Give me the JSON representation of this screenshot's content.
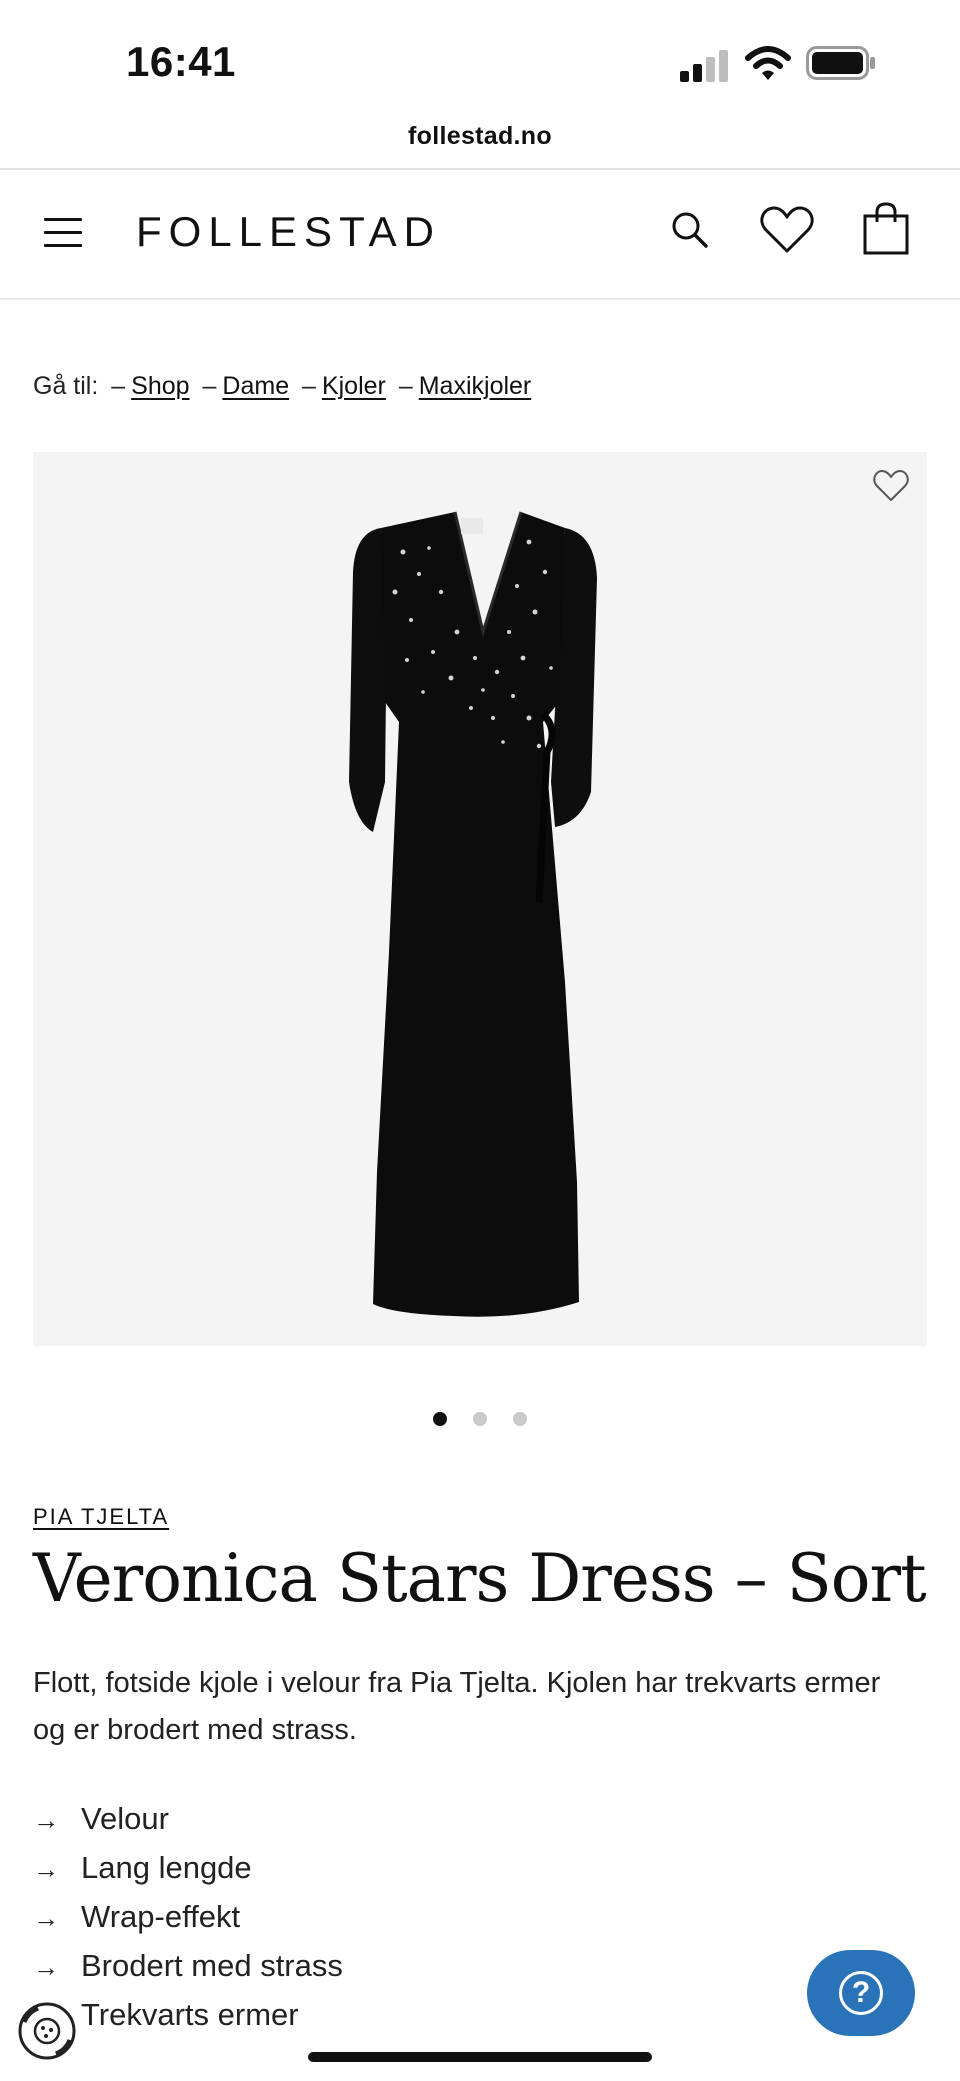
{
  "status_bar": {
    "time": "16:41"
  },
  "browser": {
    "url": "follestad.no"
  },
  "header": {
    "logo": "FOLLESTAD"
  },
  "breadcrumb": {
    "prefix": "Gå til:",
    "separator": "–",
    "items": [
      "Shop",
      "Dame",
      "Kjoler",
      "Maxikjoler"
    ]
  },
  "product": {
    "brand": "PIA TJELTA",
    "title": "Veronica Stars Dress – Sort",
    "description": "Flott, fotside kjole i velour fra Pia Tjelta. Kjolen har trekvarts ermer og er brodert med strass.",
    "features": [
      "Velour",
      "Lang lengde",
      "Wrap-effekt",
      "Brodert med strass",
      "Trekvarts ermer"
    ],
    "feature_arrow": "→",
    "image_count": 3,
    "active_image": 1
  },
  "help": {
    "icon": "?"
  },
  "icons": {
    "menu": "hamburger-icon",
    "search": "search-icon",
    "wishlist": "heart-icon",
    "cart": "shopping-bag-icon"
  },
  "colors": {
    "help_button": "#2b73b9",
    "image_bg": "#f4f4f4",
    "text": "#111111"
  }
}
